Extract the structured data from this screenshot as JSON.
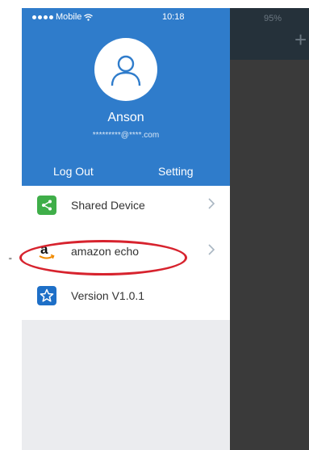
{
  "status_bar": {
    "carrier": "Mobile",
    "time": "10:18"
  },
  "right_pane": {
    "battery_text": "95%",
    "add_symbol": "+"
  },
  "user": {
    "name": "Anson",
    "email": "*********@****.com"
  },
  "actions": {
    "logout": "Log Out",
    "setting": "Setting"
  },
  "menu": {
    "items": [
      {
        "label": "Shared Device",
        "icon": "share-icon",
        "icon_color": "#3fae49",
        "has_chevron": true
      },
      {
        "label": "amazon echo",
        "icon": "amazon-logo-icon",
        "icon_color": "#ffffff",
        "has_chevron": true
      },
      {
        "label": "Version V1.0.1",
        "icon": "star-icon",
        "icon_color": "#1e6fc7",
        "has_chevron": false
      }
    ]
  },
  "colors": {
    "header_blue": "#2f7ccb",
    "highlight_red": "#d7232e"
  },
  "side_mark": "\""
}
